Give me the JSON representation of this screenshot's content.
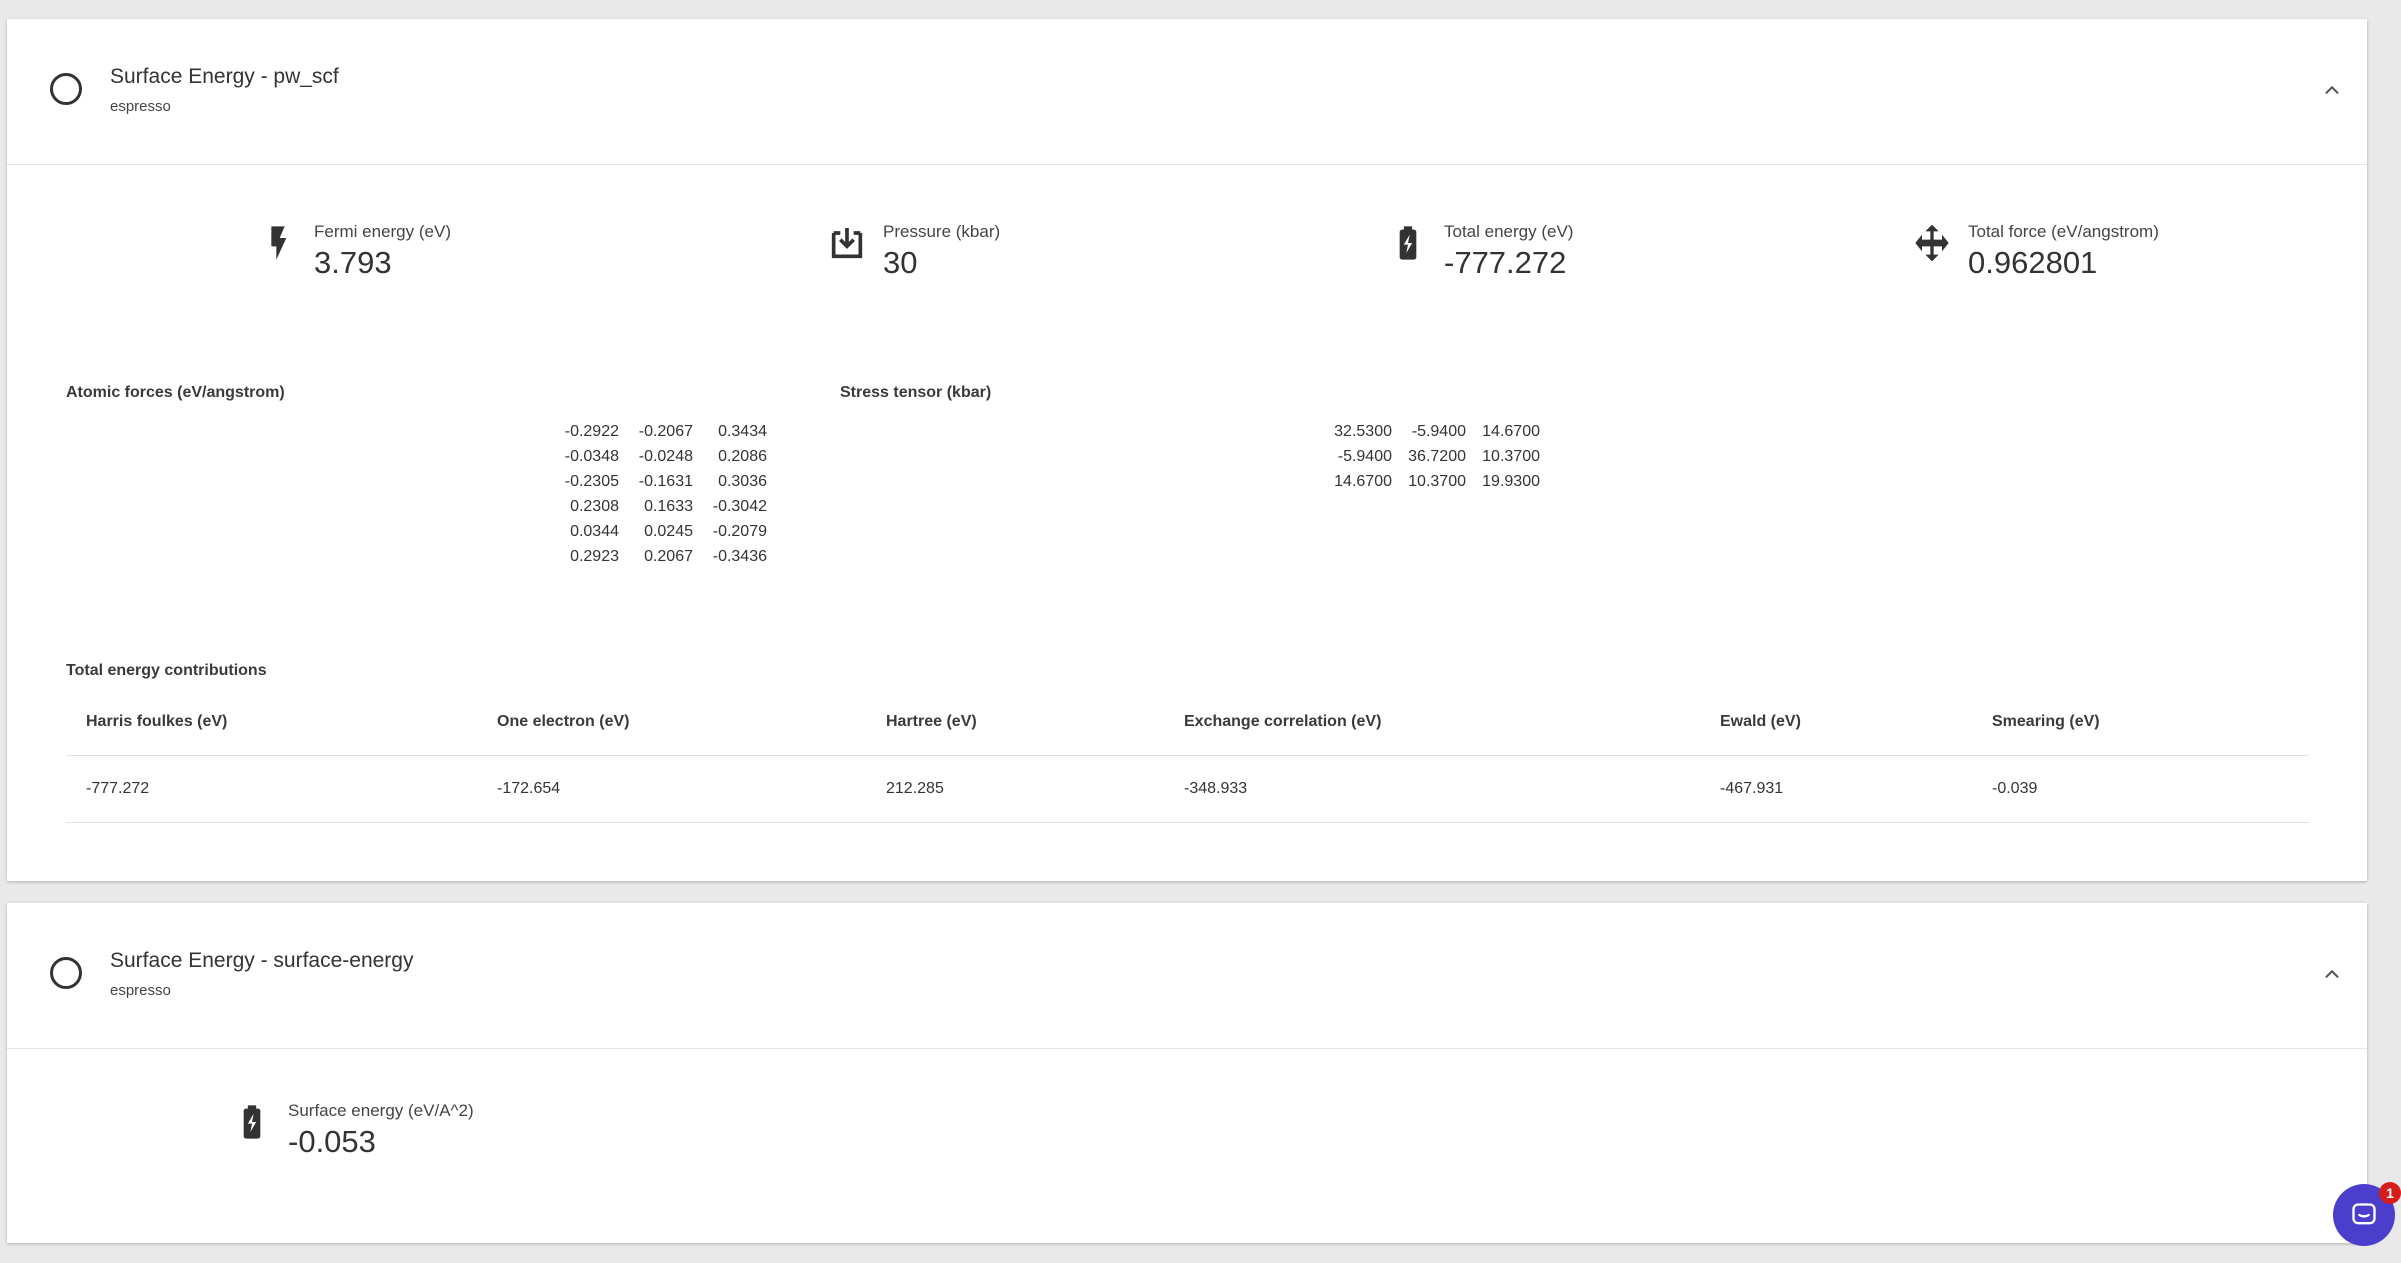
{
  "cards": [
    {
      "title": "Surface Energy - pw_scf",
      "subtitle": "espresso",
      "metrics": [
        {
          "label": "Fermi energy (eV)",
          "value": "3.793",
          "icon": "flash-icon"
        },
        {
          "label": "Pressure (kbar)",
          "value": "30",
          "icon": "download-box-icon"
        },
        {
          "label": "Total energy (eV)",
          "value": "-777.272",
          "icon": "battery-charging-icon"
        },
        {
          "label": "Total force (eV/angstrom)",
          "value": "0.962801",
          "icon": "move-arrows-icon"
        }
      ],
      "atomic_forces": {
        "title": "Atomic forces (eV/angstrom)",
        "rows": [
          [
            "-0.2922",
            "-0.2067",
            "0.3434"
          ],
          [
            "-0.0348",
            "-0.0248",
            "0.2086"
          ],
          [
            "-0.2305",
            "-0.1631",
            "0.3036"
          ],
          [
            "0.2308",
            "0.1633",
            "-0.3042"
          ],
          [
            "0.0344",
            "0.0245",
            "-0.2079"
          ],
          [
            "0.2923",
            "0.2067",
            "-0.3436"
          ]
        ]
      },
      "stress_tensor": {
        "title": "Stress tensor (kbar)",
        "rows": [
          [
            "32.5300",
            "-5.9400",
            "14.6700"
          ],
          [
            "-5.9400",
            "36.7200",
            "10.3700"
          ],
          [
            "14.6700",
            "10.3700",
            "19.9300"
          ]
        ]
      },
      "energy_contributions": {
        "title": "Total energy contributions",
        "headers": [
          "Harris foulkes (eV)",
          "One electron (eV)",
          "Hartree (eV)",
          "Exchange correlation (eV)",
          "Ewald (eV)",
          "Smearing (eV)"
        ],
        "values": [
          "-777.272",
          "-172.654",
          "212.285",
          "-348.933",
          "-467.931",
          "-0.039"
        ]
      }
    },
    {
      "title": "Surface Energy - surface-energy",
      "subtitle": "espresso",
      "metrics": [
        {
          "label": "Surface energy (eV/A^2)",
          "value": "-0.053",
          "icon": "battery-charging-icon"
        }
      ]
    }
  ],
  "chat": {
    "badge_count": "1",
    "icon": "chat-icon"
  },
  "colors": {
    "accent": "#4b3ecd",
    "badge": "#d81b1b",
    "background": "#e9e9e9"
  }
}
